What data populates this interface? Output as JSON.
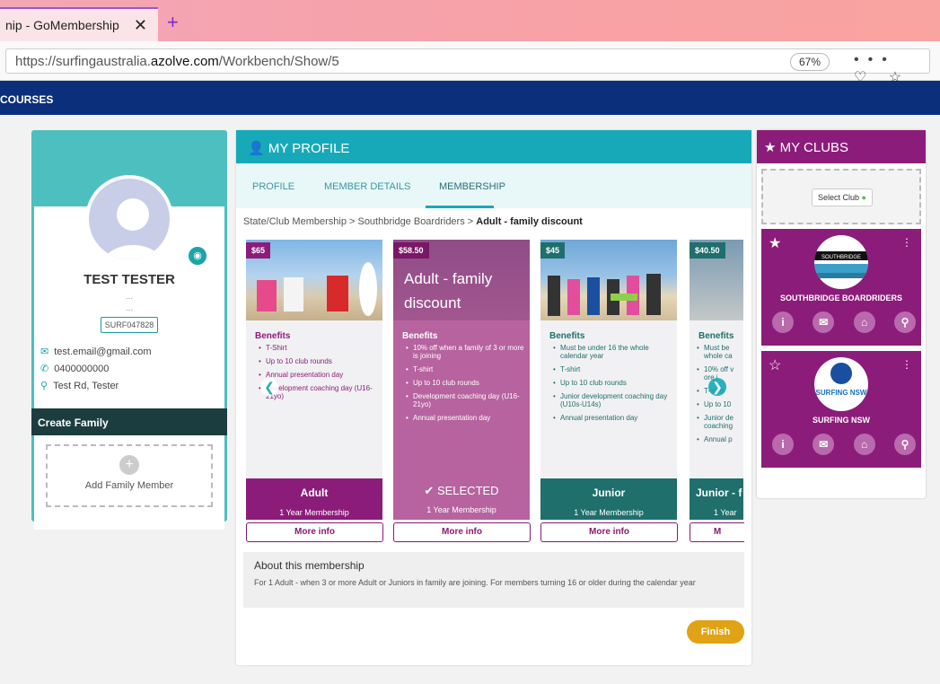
{
  "browser": {
    "tab_title": "nip - GoMembership",
    "close": "✕",
    "new_tab": "+",
    "url_host_prefix": "https://surfingaustralia.",
    "url_domain": "azolve.com",
    "url_path": "/Workbench/Show/5",
    "zoom": "67%",
    "toolbar_icons": "••• ♡ ☆"
  },
  "nav": {
    "item": "COURSES"
  },
  "profile_card": {
    "name": "TEST TESTER",
    "dots1": "...",
    "dots2": "...",
    "member_id": "SURF047828",
    "email": "test.email@gmail.com",
    "phone": "0400000000",
    "address": "Test Rd, Tester",
    "create_family": "Create Family",
    "add_family": "Add Family Member"
  },
  "main": {
    "title": "MY PROFILE",
    "tabs": [
      "PROFILE",
      "MEMBER DETAILS",
      "MEMBERSHIP"
    ],
    "crumb": "State/Club Membership > Southbridge Boardriders > ",
    "crumb_current": "Adult - family discount",
    "cards": [
      {
        "price": "$65",
        "benefits_label": "Benefits",
        "benefits": [
          "T-Shirt",
          "Up to 10 club rounds",
          "Annual presentation day",
          "Development coaching day (U16-21yo)"
        ],
        "title": "Adult",
        "sub": "1 Year Membership",
        "more": "More info"
      },
      {
        "price": "$58.50",
        "overlay": "Adult - family discount",
        "benefits_label": "Benefits",
        "benefits": [
          "10% off when a family of 3 or more is joining",
          "T-shirt",
          "Up to 10 club rounds",
          "Development coaching day (U16-21yo)",
          "Annual presentation day"
        ],
        "title": "SELECTED",
        "sub": "1 Year Membership",
        "more": "More info"
      },
      {
        "price": "$45",
        "benefits_label": "Benefits",
        "benefits": [
          "Must be under 16 the whole calendar year",
          "T-shirt",
          "Up to 10 club rounds",
          "Junior development coaching day (U10s-U14s)",
          "Annual presentation day"
        ],
        "title": "Junior",
        "sub": "1 Year Membership",
        "more": "More info"
      },
      {
        "price": "$40.50",
        "benefits_label": "Benefits",
        "benefits": [
          "Must be whole ca",
          "10% off v ore i",
          "T-shirt",
          "Up to 10",
          "Junior de coaching",
          "Annual p"
        ],
        "title": "Junior - f",
        "sub": "1 Year",
        "more": "M"
      }
    ],
    "about_title": "About this membership",
    "about_text": "For 1 Adult - when 3 or more Adult or Juniors in family are joining. For members turning 16 or older during the calendar year",
    "finish": "Finish"
  },
  "clubs": {
    "title": "MY CLUBS",
    "select": "Select Club",
    "items": [
      {
        "name": "SOUTHBRIDGE BOARDRIDERS",
        "logo_text": "SOUTHBRIDGE"
      },
      {
        "name": "SURFING NSW",
        "logo_text": "SURFING NSW"
      }
    ]
  },
  "colors": {
    "teal": "#17a9b8",
    "purple": "#8c1c7a",
    "dark_teal": "#1f6f6c",
    "navy": "#0b2f7a",
    "gold": "#e0a315"
  }
}
